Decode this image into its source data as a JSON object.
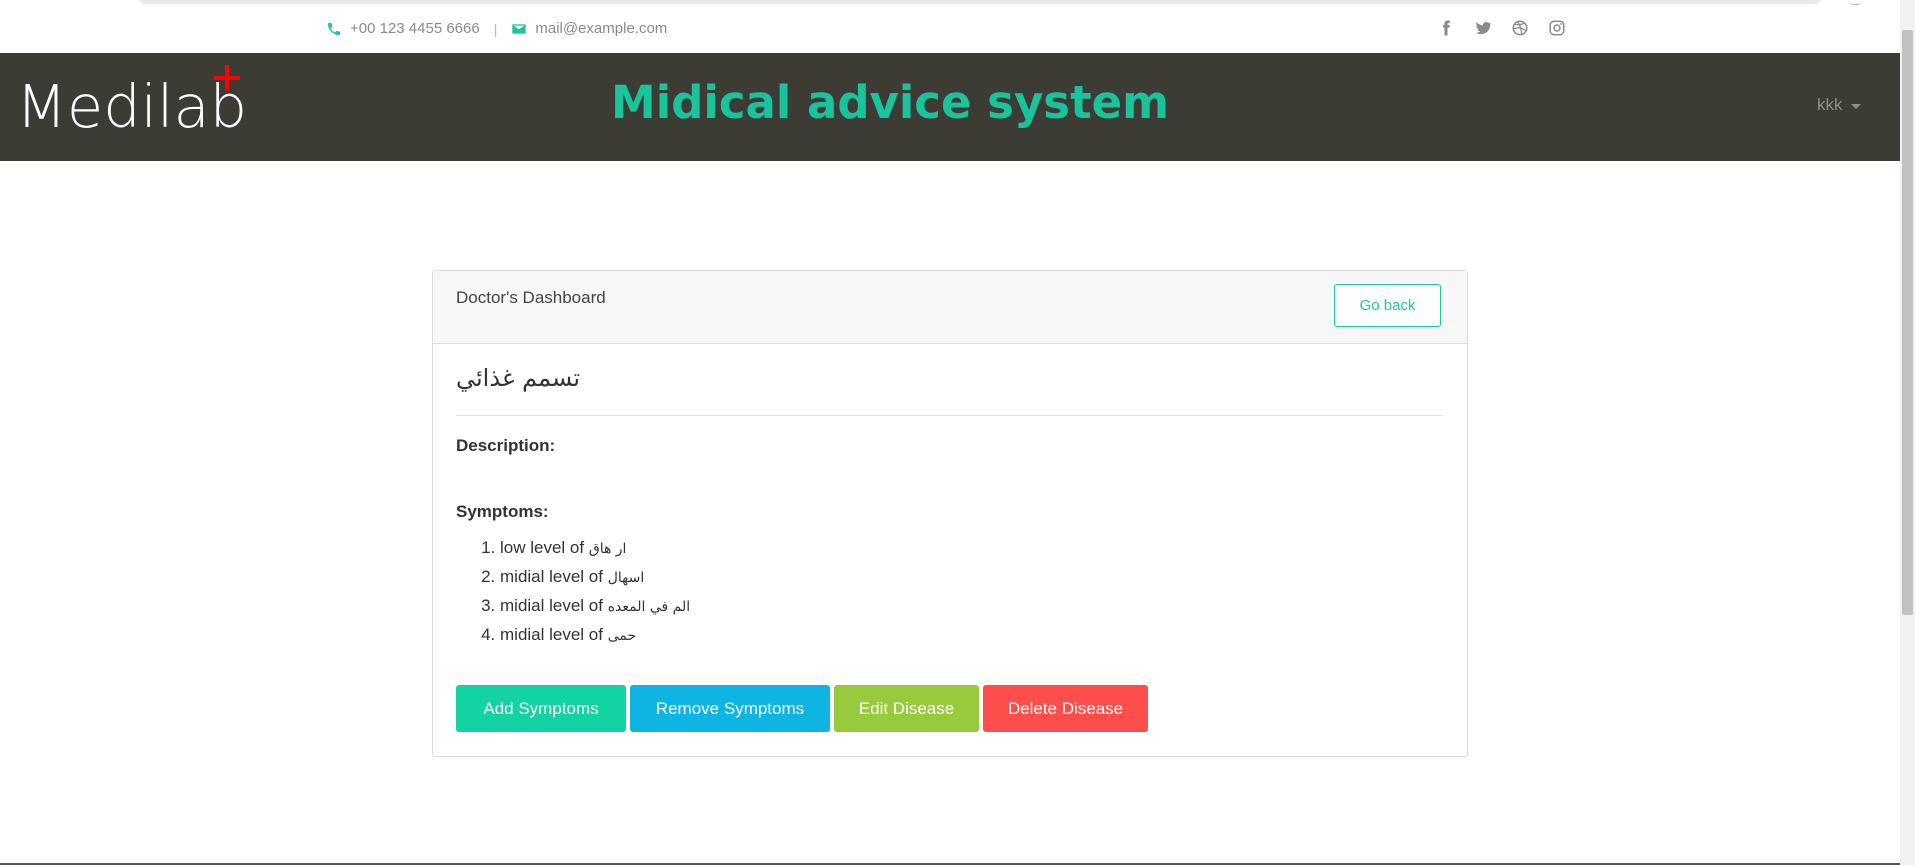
{
  "topbar": {
    "phone": "+00 123 4455 6666",
    "separator": "|",
    "email": "mail@example.com",
    "social_icons": [
      "facebook-icon",
      "twitter-icon",
      "dribbble-icon",
      "instagram-icon"
    ]
  },
  "header": {
    "logo_text": "Medilab",
    "logo_icon": "plus-icon",
    "title": "Midical advice system",
    "user": "kkk"
  },
  "card": {
    "header_title": "Doctor's Dashboard",
    "go_back_label": "Go back",
    "disease_name": "تسمم غذائي",
    "description_label": "Description:",
    "symptoms_label": "Symptoms:",
    "symptoms": [
      {
        "prefix": "low level of ",
        "name": "ار هاق"
      },
      {
        "prefix": "midial level of ",
        "name": "اسهال"
      },
      {
        "prefix": "midial level of ",
        "name": "الم في المعده"
      },
      {
        "prefix": "midial level of ",
        "name": "حمى"
      }
    ],
    "buttons": {
      "add": "Add Symptoms",
      "remove": "Remove Symptoms",
      "edit": "Edit Disease",
      "delete": "Delete Disease"
    }
  },
  "colors": {
    "accent": "#1ec89f",
    "header_bg": "#3c3c35",
    "add": "#13d3a3",
    "remove": "#0eb5e2",
    "edit": "#99c93d",
    "delete": "#fd4e4b",
    "logo_plus": "#ff0000"
  }
}
